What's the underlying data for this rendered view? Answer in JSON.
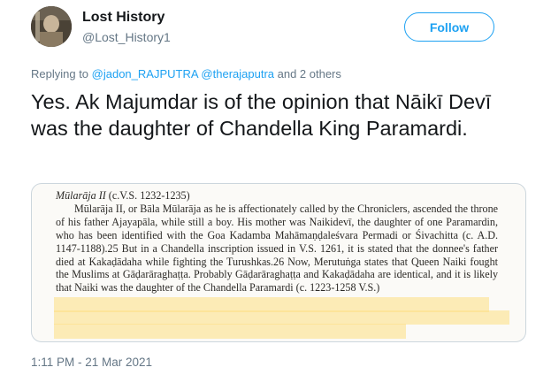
{
  "author": {
    "name": "Lost History",
    "handle": "@Lost_History1"
  },
  "follow_label": "Follow",
  "replying": {
    "prefix": "Replying to ",
    "mention1": "@jadon_RAJPUTRA",
    "mention2": "@therajaputra",
    "suffix": " and 2 others"
  },
  "tweet_text": "Yes. Ak Majumdar is of the opinion that Nāikī Devī was the daughter of Chandella King Paramardi.",
  "image_text": {
    "heading_italic": "Mūlarāja II",
    "heading_rest": " (c.V.S. 1232-1235)",
    "paragraph": "Mūlarāja II, or Bāla Mūlarāja as he is affectionately called by the Chroniclers, ascended the throne of his father Ajayapāla, while still a boy. His mother was Naikidevī, the daughter of one Paramardin, who has been identified with the Goa Kadamba Mahāmaṇḍaleśvara Permadi or Śivachitta (c. A.D. 1147-1188).25 But in a Chandella inscription issued in V.S. 1261, it is stated that the donnee's father died at Kakaḍādaha while fighting the Turushkas.26 Now, Merutuṅga states that Queen Naiki fought the Muslims at Gāḍarāraghaṭṭa. Probably Gāḍarāraghaṭṭa and Kakaḍādaha are identical, and it is likely that Naiki was the daughter of the Chandella Paramardi (c. 1223-1258 V.S.)"
  },
  "timestamp": "1:11 PM - 21 Mar 2021",
  "colors": {
    "accent": "#1da1f2",
    "secondary_text": "#657786",
    "highlight": "#fdde82"
  }
}
